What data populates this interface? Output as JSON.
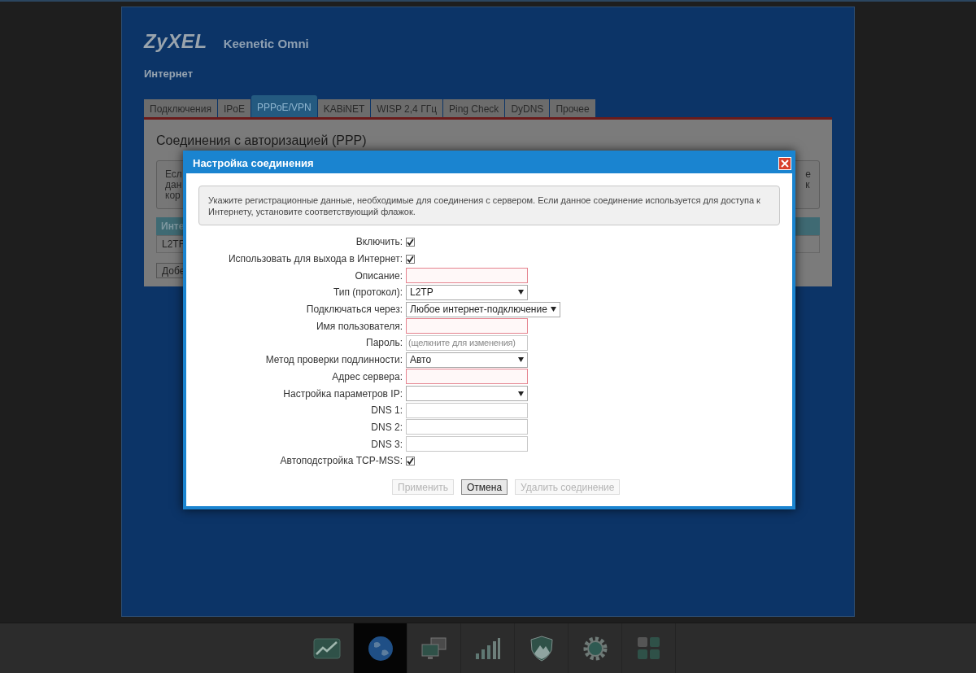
{
  "header": {
    "logo": "ZyXEL",
    "model": "Keenetic Omni",
    "section": "Интернет"
  },
  "tabs": [
    {
      "label": "Подключения",
      "selected": false
    },
    {
      "label": "IPoE",
      "selected": false
    },
    {
      "label": "PPPoE/VPN",
      "selected": true
    },
    {
      "label": "KABiNET",
      "selected": false
    },
    {
      "label": "WISP 2,4 ГГц",
      "selected": false
    },
    {
      "label": "Ping Check",
      "selected": false
    },
    {
      "label": "DyDNS",
      "selected": false
    },
    {
      "label": "Прочее",
      "selected": false
    }
  ],
  "page": {
    "title": "Соединения с авторизацией (PPP)",
    "info_left": [
      "Есл",
      "дан",
      "кор"
    ],
    "info_right": [
      "е",
      "к"
    ],
    "table_header": "Инте",
    "table_cell": "L2TF",
    "add_button": "Добе"
  },
  "dialog": {
    "title": "Настройка соединения",
    "info": "Укажите регистрационные данные, необходимые для соединения с сервером. Если данное соединение используется для доступа к Интернету, установите соответствующий флажок.",
    "fields": [
      {
        "kind": "checkbox",
        "label": "Включить:",
        "checked": true
      },
      {
        "kind": "checkbox",
        "label": "Использовать для выхода в Интернет:",
        "checked": true
      },
      {
        "kind": "text",
        "label": "Описание:",
        "required": true
      },
      {
        "kind": "select",
        "label": "Тип (протокол):",
        "value": "L2TP"
      },
      {
        "kind": "select",
        "label": "Подключаться через:",
        "value": "Любое интернет-подключение"
      },
      {
        "kind": "text",
        "label": "Имя пользователя:",
        "required": true
      },
      {
        "kind": "text",
        "label": "Пароль:",
        "placeholder": "(щелкните для изменения)",
        "required": false
      },
      {
        "kind": "select",
        "label": "Метод проверки подлинности:",
        "value": "Авто"
      },
      {
        "kind": "text",
        "label": "Адрес сервера:",
        "required": true
      },
      {
        "kind": "select",
        "label": "Настройка параметров IP:"
      },
      {
        "kind": "text",
        "label": "DNS 1:",
        "required": false
      },
      {
        "kind": "text",
        "label": "DNS 2:",
        "required": false
      },
      {
        "kind": "text",
        "label": "DNS 3:",
        "required": false
      },
      {
        "kind": "checkbox",
        "label": "Автоподстройка TCP-MSS:",
        "checked": true
      }
    ],
    "buttons": [
      {
        "label": "Применить",
        "disabled": true
      },
      {
        "label": "Отмена",
        "disabled": false
      },
      {
        "label": "Удалить соединение",
        "disabled": true
      }
    ]
  },
  "nav": [
    {
      "kind": "chart",
      "selected": false
    },
    {
      "kind": "globe",
      "selected": true
    },
    {
      "kind": "monitors",
      "selected": false
    },
    {
      "kind": "signal",
      "selected": false
    },
    {
      "kind": "shield",
      "selected": false
    },
    {
      "kind": "gear",
      "selected": false
    },
    {
      "kind": "grid",
      "selected": false
    }
  ]
}
